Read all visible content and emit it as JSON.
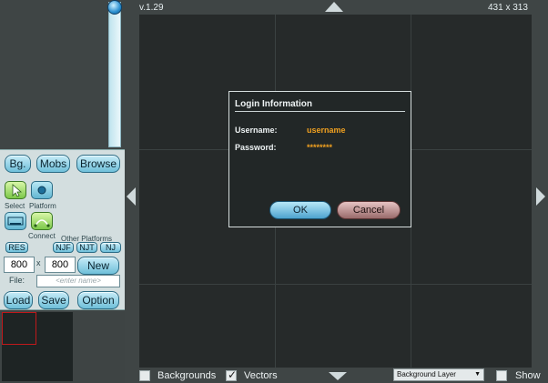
{
  "header": {
    "version": "v.1.29",
    "dimensions": "431 x 313"
  },
  "toolbar": {
    "bg_label": "Bg.",
    "mobs_label": "Mobs",
    "browse_label": "Browse",
    "select_label": "Select",
    "platform_label": "Platform",
    "connect_label": "Connect",
    "other_platforms_label": "Other Platforms",
    "res_label": "RES",
    "njf_label": "NJF",
    "njt_label": "NJT",
    "nj_label": "NJ",
    "width_value": "800",
    "height_value": "800",
    "size_separator": "x",
    "new_label": "New",
    "file_label": "File:",
    "file_placeholder": "<enter name>",
    "load_label": "Load",
    "save_label": "Save",
    "option_label": "Option"
  },
  "bottom_bar": {
    "backgrounds_label": "Backgrounds",
    "backgrounds_checked": false,
    "vectors_label": "Vectors",
    "vectors_checked": true,
    "layer_select_value": "Background Layer",
    "show_label": "Show",
    "show_checked": false
  },
  "dialog": {
    "title": "Login Information",
    "username_label": "Username:",
    "username_value": "username",
    "password_label": "Password:",
    "password_value": "********",
    "ok_label": "OK",
    "cancel_label": "Cancel"
  },
  "icons": [
    "select-icon",
    "platform-icon",
    "portal-icon",
    "connect-icon",
    "arrow-up-icon",
    "arrow-down-icon",
    "arrow-left-icon",
    "arrow-right-icon",
    "check-icon",
    "caret-down-icon"
  ],
  "colors": {
    "accent": "#6fbfd9",
    "dialog_value": "#f0a020",
    "canvas_bg": "#262a2a",
    "panel_bg": "#3f4545",
    "minimap_frame": "#c0191b"
  }
}
